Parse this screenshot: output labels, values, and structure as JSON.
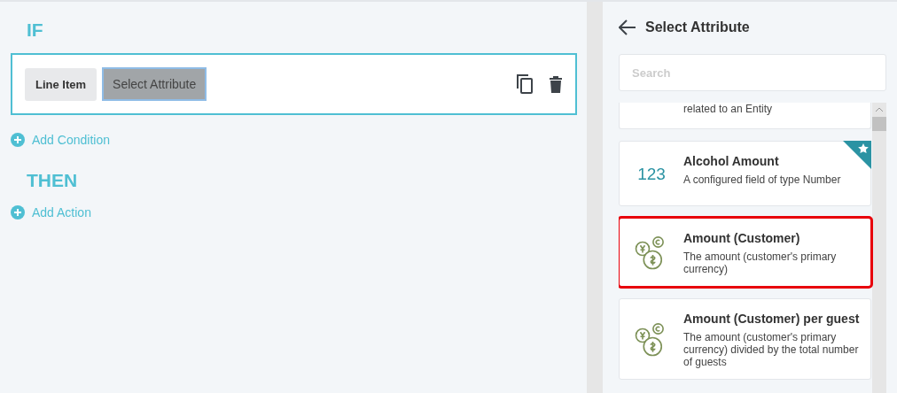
{
  "rule": {
    "if_label": "IF",
    "condition": {
      "entity": "Line Item",
      "attribute": "Select Attribute"
    },
    "add_condition": "Add Condition",
    "then_label": "THEN",
    "add_action": "Add Action"
  },
  "attribute_panel": {
    "title": "Select Attribute",
    "search": {
      "placeholder": "Search"
    },
    "items": [
      {
        "kind": "partial",
        "description": "related to an Entity",
        "favorite": false,
        "highlighted": false
      },
      {
        "kind": "number",
        "icon_text": "123",
        "name": "Alcohol Amount",
        "description": "A configured field of type Number",
        "favorite": true,
        "highlighted": false
      },
      {
        "kind": "currency",
        "name": "Amount (Customer)",
        "description": "The amount (customer's primary currency)",
        "favorite": false,
        "highlighted": true
      },
      {
        "kind": "currency",
        "name": "Amount (Customer) per guest",
        "description": "The amount (customer's primary currency) divided by the total number of guests",
        "favorite": false,
        "highlighted": false
      }
    ]
  }
}
